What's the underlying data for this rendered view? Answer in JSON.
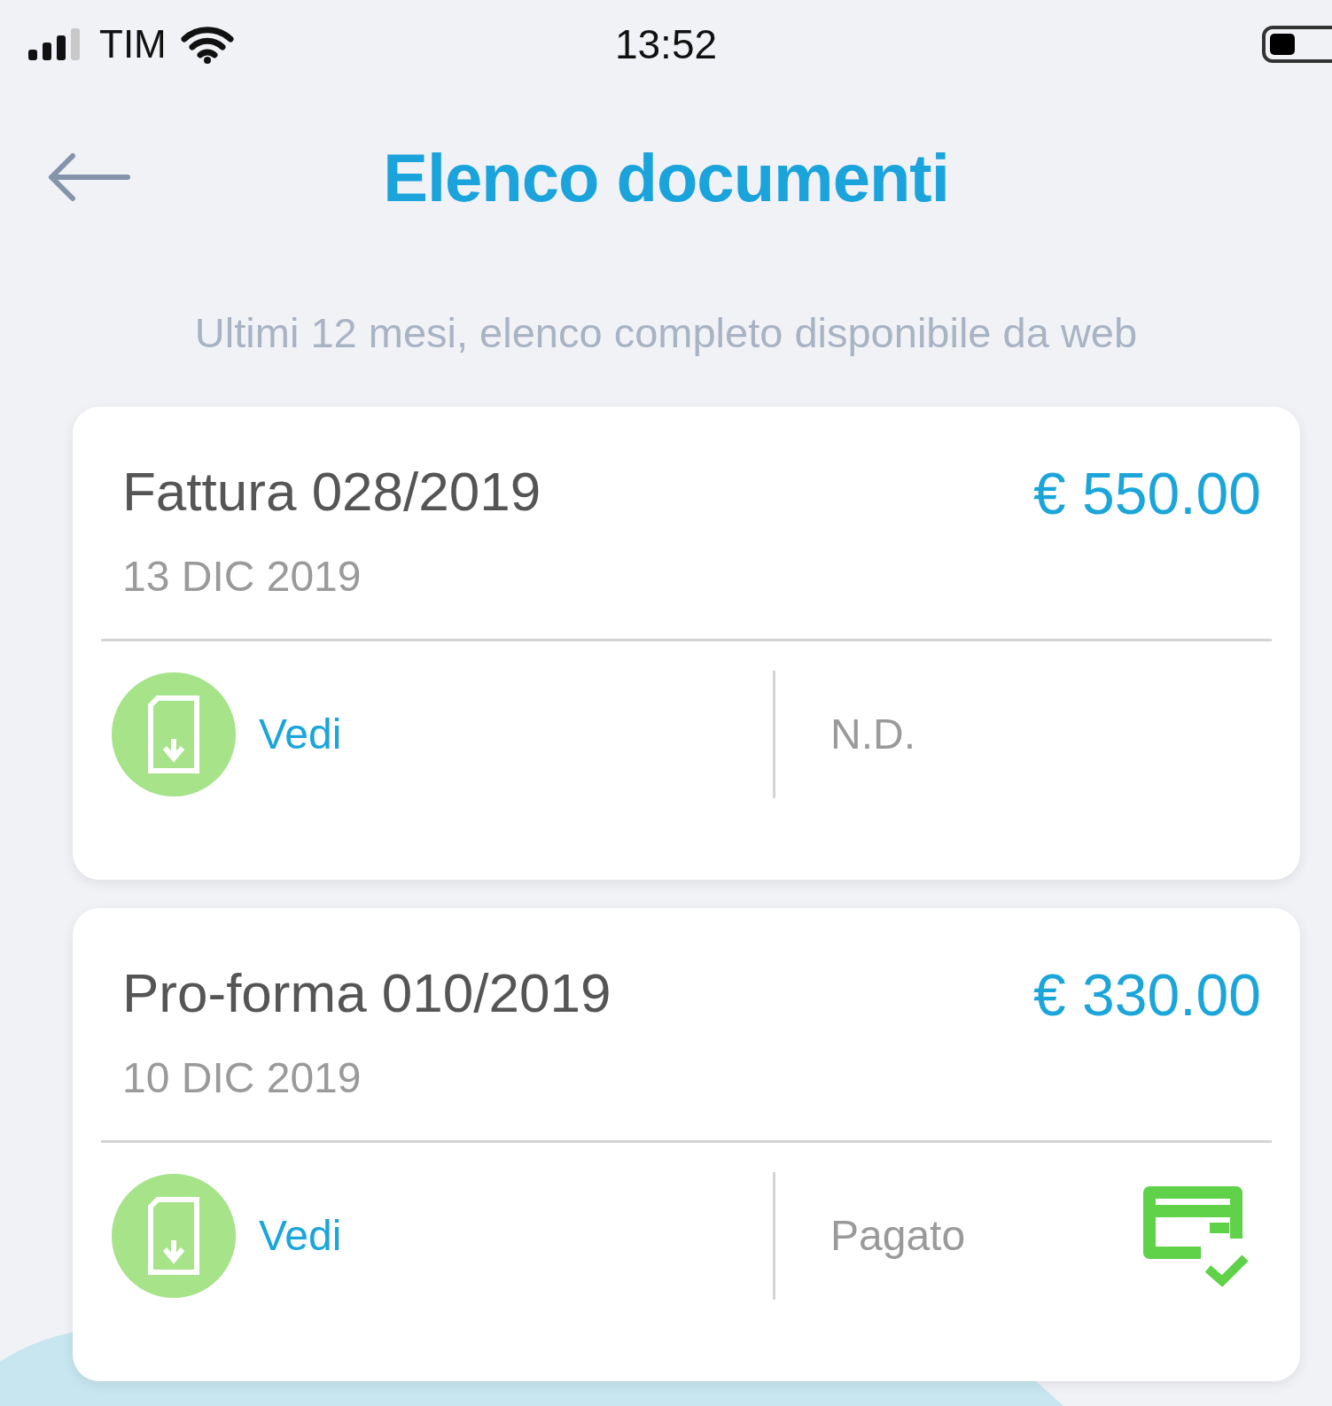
{
  "status_bar": {
    "carrier": "TIM",
    "time": "13:52"
  },
  "header": {
    "title": "Elenco documenti"
  },
  "subtitle": "Ultimi 12 mesi, elenco completo disponibile da web",
  "documents": [
    {
      "title": "Fattura 028/2019",
      "date": "13 DIC 2019",
      "amount": "€ 550.00",
      "action": "Vedi",
      "status": "N.D.",
      "paid": false
    },
    {
      "title": "Pro-forma 010/2019",
      "date": "10 DIC 2019",
      "amount": "€ 330.00",
      "action": "Vedi",
      "status": "Pagato",
      "paid": true
    }
  ]
}
